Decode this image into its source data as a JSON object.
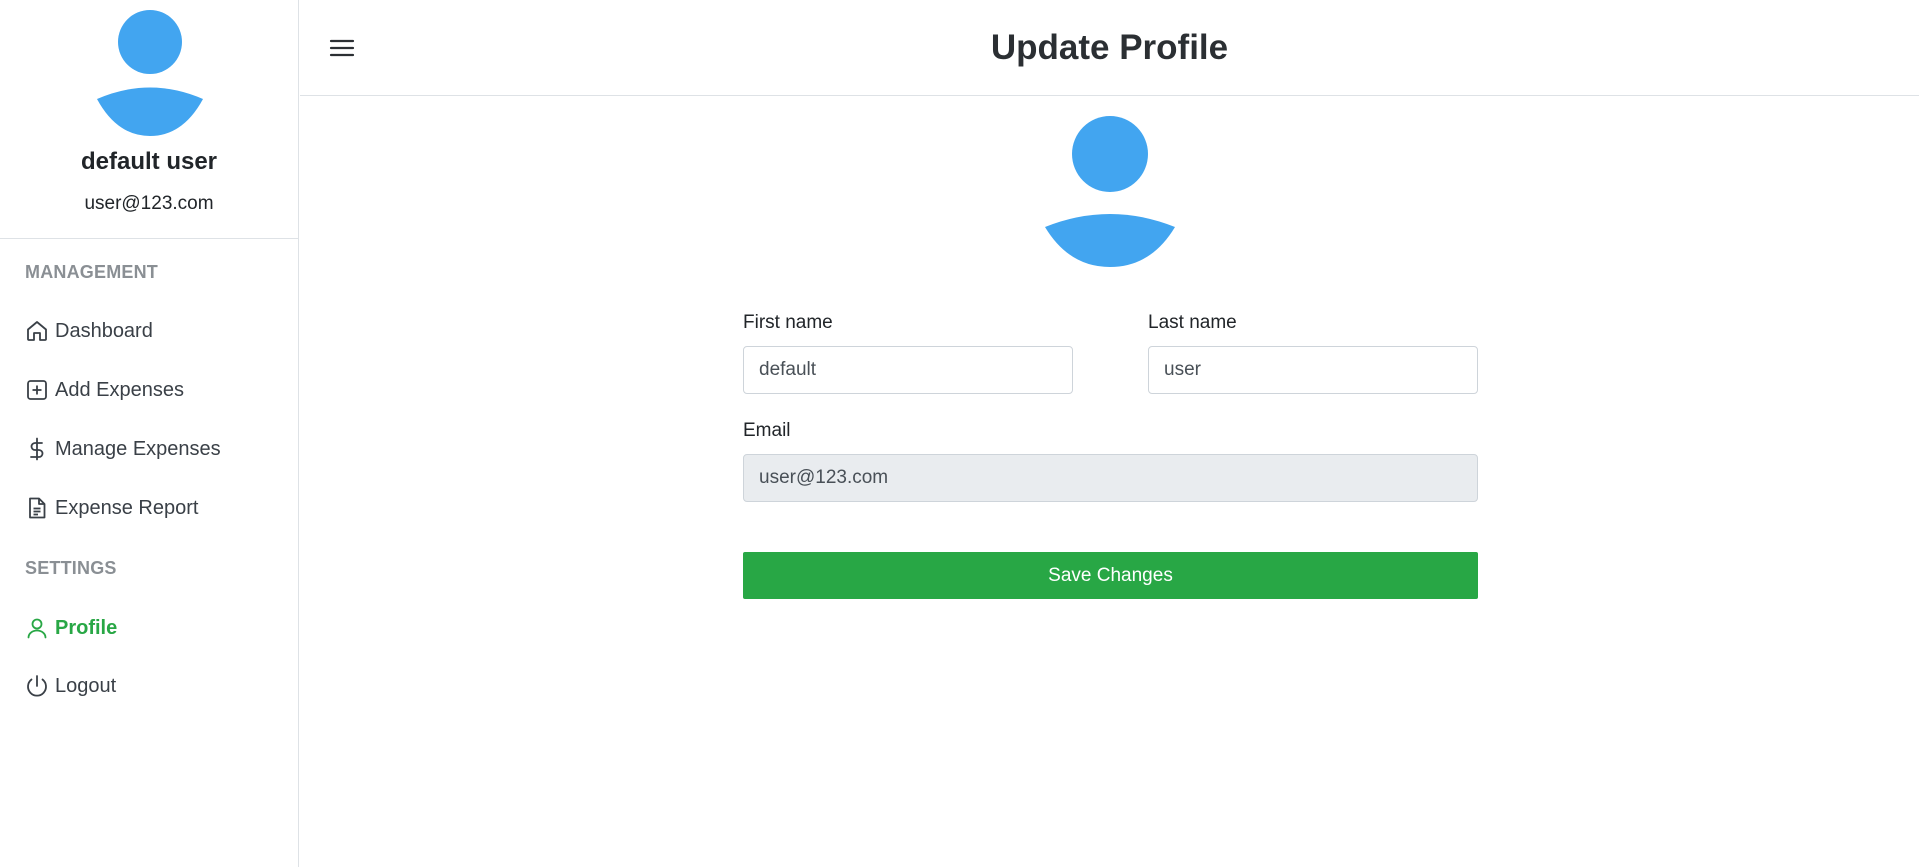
{
  "sidebar": {
    "user_name": "default user",
    "user_email": "user@123.com",
    "sections": {
      "management": "MANAGEMENT",
      "settings": "SETTINGS"
    },
    "items": [
      {
        "label": "Dashboard",
        "icon": "home-icon"
      },
      {
        "label": "Add Expenses",
        "icon": "plus-square-icon"
      },
      {
        "label": "Manage Expenses",
        "icon": "dollar-icon"
      },
      {
        "label": "Expense Report",
        "icon": "file-text-icon"
      },
      {
        "label": "Profile",
        "icon": "user-icon",
        "active": true
      },
      {
        "label": "Logout",
        "icon": "power-icon"
      }
    ]
  },
  "header": {
    "title": "Update Profile",
    "menu_icon": "hamburger-menu-icon"
  },
  "form": {
    "first_name_label": "First name",
    "first_name_value": "default",
    "last_name_label": "Last name",
    "last_name_value": "user",
    "email_label": "Email",
    "email_value": "user@123.com",
    "save_label": "Save Changes"
  },
  "colors": {
    "accent_green": "#28a745",
    "avatar_blue": "#42a5f0",
    "section_gray": "#8a8f94"
  }
}
